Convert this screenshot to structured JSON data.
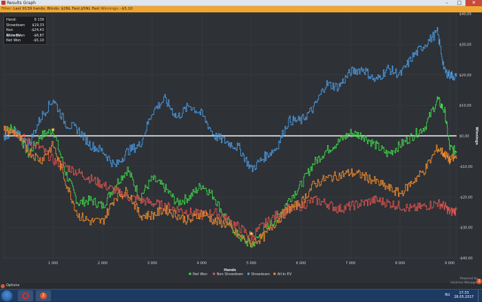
{
  "window": {
    "title": "Results Graph",
    "controls": {
      "minimize": "–",
      "maximize": "□",
      "close": "✕"
    }
  },
  "filter": {
    "label": "Filter:",
    "text": "Last 9139 hands; Blinds: $2NL Fast,$5NL Fast",
    "winnings_label": "Winnings:",
    "winnings_value": "-$5,10"
  },
  "stats": [
    {
      "label": "Hand:",
      "value": "9 139"
    },
    {
      "label": "Showdown",
      "value": "$19,33"
    },
    {
      "label": "Non Showdown",
      "value": "-$24,43"
    },
    {
      "label": "All-In EV",
      "value": "-$6,87"
    },
    {
      "label": "Net Won",
      "value": "-$5,10"
    }
  ],
  "colors": {
    "net_won": "#3fd44a",
    "non_showdown": "#d9534f",
    "showdown": "#4a9ae0",
    "allin_ev": "#ee8a2c",
    "zero_line": "#ffffff",
    "grid": "#3c4046"
  },
  "footer": {
    "options_label": "Options",
    "brand_line1": "Powered by",
    "brand_line2": "Hold'em Manager",
    "brand_badge": "2"
  },
  "taskbar": {
    "lang": "RU",
    "time": "17:33",
    "date": "28.05.2017"
  },
  "chart_data": {
    "type": "line",
    "xlabel": "Hands",
    "ylabel": "Winnings",
    "xlim": [
      0,
      9139
    ],
    "ylim": [
      -40,
      40
    ],
    "x_ticks": [
      {
        "value": 1000,
        "label": "1 000"
      },
      {
        "value": 2000,
        "label": "2 000"
      },
      {
        "value": 3000,
        "label": "3 000"
      },
      {
        "value": 4000,
        "label": "4 000"
      },
      {
        "value": 5000,
        "label": "5 000"
      },
      {
        "value": 6000,
        "label": "6 000"
      },
      {
        "value": 7000,
        "label": "7 000"
      },
      {
        "value": 8000,
        "label": "8 000"
      },
      {
        "value": 9000,
        "label": "9 000"
      }
    ],
    "y_ticks": [
      {
        "value": 40,
        "label": "$40,00"
      },
      {
        "value": 30,
        "label": "$30,00"
      },
      {
        "value": 20,
        "label": "$20,00"
      },
      {
        "value": 10,
        "label": "$10,00"
      },
      {
        "value": 0,
        "label": "$0,00"
      },
      {
        "value": -10,
        "label": "-$10,00"
      },
      {
        "value": -20,
        "label": "-$20,00"
      },
      {
        "value": -30,
        "label": "-$30,00"
      },
      {
        "value": -40,
        "label": "-$40,00"
      }
    ],
    "grid": true,
    "legend_position": "bottom",
    "x": [
      0,
      250,
      500,
      750,
      1000,
      1250,
      1500,
      1750,
      2000,
      2250,
      2500,
      2750,
      3000,
      3250,
      3500,
      3750,
      4000,
      4250,
      4500,
      4750,
      5000,
      5250,
      5500,
      5750,
      6000,
      6250,
      6500,
      6750,
      7000,
      7250,
      7500,
      7750,
      8000,
      8250,
      8500,
      8750,
      8900,
      9000,
      9139
    ],
    "series": [
      {
        "name": "Net Won",
        "key": "net_won",
        "values": [
          3,
          2,
          -6,
          0,
          2,
          -12,
          -22,
          -21,
          -23,
          -16,
          -11,
          -20,
          -14,
          -17,
          -22,
          -20,
          -16,
          -20,
          -28,
          -33,
          -36,
          -31,
          -27,
          -21,
          -16,
          -9,
          -5,
          -2,
          1,
          0,
          -3,
          -6,
          -3,
          0,
          3,
          12,
          8,
          -4,
          -5.1
        ]
      },
      {
        "name": "Non Showdown",
        "key": "non_showdown",
        "values": [
          3,
          1,
          -2,
          -4,
          -8,
          -10,
          -12,
          -14,
          -16,
          -18,
          -20,
          -21,
          -22,
          -23,
          -24,
          -25,
          -26,
          -25,
          -27,
          -30,
          -33,
          -29,
          -26,
          -24,
          -23,
          -21,
          -22,
          -24,
          -23,
          -22,
          -21,
          -22,
          -23,
          -24,
          -23,
          -22,
          -23,
          -25,
          -24.4
        ]
      },
      {
        "name": "Showdown",
        "key": "showdown",
        "values": [
          0,
          1,
          -3,
          6,
          12,
          4,
          2,
          -3,
          -5,
          -10,
          -5,
          -3,
          8,
          12,
          6,
          10,
          7,
          0,
          -2,
          -4,
          -11,
          -7,
          -4,
          5,
          5,
          9,
          17,
          16,
          21,
          22,
          18,
          22,
          20,
          26,
          30,
          34,
          21,
          20,
          19.3
        ]
      },
      {
        "name": "All-In EV",
        "key": "allin_ev",
        "values": [
          2,
          1,
          -5,
          -8,
          -3,
          -15,
          -26,
          -28,
          -28,
          -20,
          -18,
          -26,
          -26,
          -24,
          -26,
          -28,
          -25,
          -28,
          -29,
          -33,
          -35,
          -33,
          -28,
          -24,
          -22,
          -16,
          -14,
          -13,
          -12,
          -13,
          -15,
          -17,
          -19,
          -15,
          -11,
          -4,
          -6,
          -8,
          -6.9
        ]
      }
    ],
    "markers": [
      {
        "series": "net_won",
        "x": 1000,
        "y": 2
      },
      {
        "series": "net_won",
        "x": 5000,
        "y": -32
      }
    ]
  }
}
